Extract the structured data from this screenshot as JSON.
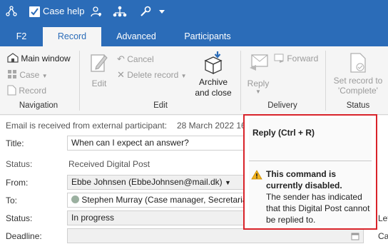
{
  "titlebar": {
    "case_help_label": "Case help"
  },
  "tabs": [
    {
      "label": "F2"
    },
    {
      "label": "Record"
    },
    {
      "label": "Advanced"
    },
    {
      "label": "Participants"
    }
  ],
  "ribbon": {
    "navigation": {
      "main_window": "Main window",
      "case": "Case",
      "record": "Record",
      "group_label": "Navigation"
    },
    "edit": {
      "edit": "Edit",
      "cancel": "Cancel",
      "delete_record": "Delete record",
      "archive_line1": "Archive",
      "archive_line2": "and close",
      "group_label": "Edit"
    },
    "delivery": {
      "reply": "Reply",
      "forward": "Forward",
      "group_label": "Delivery"
    },
    "status": {
      "set_record_line1": "Set record to",
      "set_record_line2": "'Complete'",
      "group_label": "Status"
    }
  },
  "form": {
    "info_text": "Email is received from external participant:",
    "info_date": "28 March 2022 16",
    "title_label": "Title:",
    "title_value": "When can I expect an answer?",
    "status_label1": "Status:",
    "status_value1": "Received Digital Post",
    "from_label": "From:",
    "from_value": "Ebbe Johnsen (EbbeJohnsen@mail.dk)",
    "to_label": "To:",
    "to_value": "Stephen Murray (Case manager, Secretariat",
    "status_label2": "Status:",
    "status_value2": "In progress",
    "deadline_label": "Deadline:",
    "right_partial1": "Let",
    "right_partial2": "Cas"
  },
  "tooltip": {
    "title": "Reply (Ctrl + R)",
    "warning": "This command is currently disabled.",
    "description": "The sender has indicated that this Digital Post cannot be replied to."
  },
  "colors": {
    "accent": "#2b6cb8",
    "highlight_border": "#d9232a",
    "warning": "#f2b21b"
  }
}
